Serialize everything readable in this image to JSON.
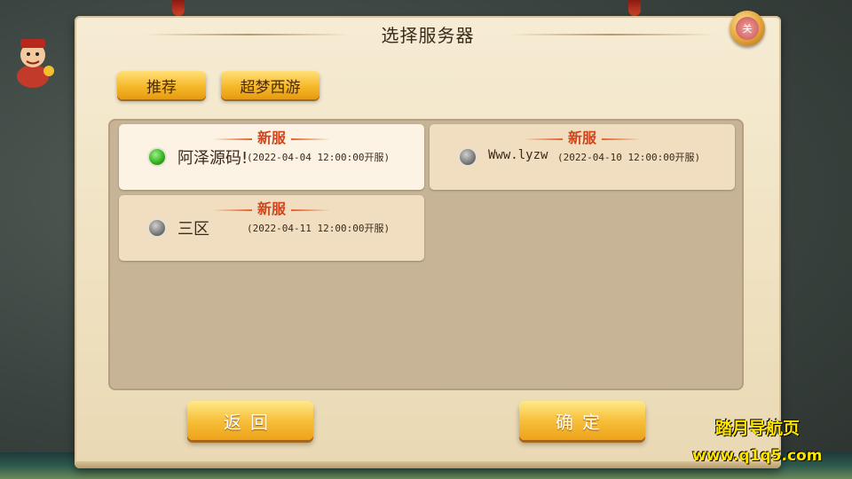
{
  "dialog": {
    "title": "选择服务器",
    "close_label": "关"
  },
  "tabs": [
    {
      "label": "推荐"
    },
    {
      "label": "超梦西游"
    }
  ],
  "servers": [
    {
      "badge": "新服",
      "name": "阿泽源码!",
      "time": "(2022-04-04 12:00:00开服)",
      "selected": true
    },
    {
      "badge": "新服",
      "name": "Www.lyzw",
      "time": "(2022-04-10 12:00:00开服)",
      "selected": false
    },
    {
      "badge": "新服",
      "name": "三区",
      "time": "(2022-04-11 12:00:00开服)",
      "selected": false
    }
  ],
  "buttons": {
    "back": "返回",
    "confirm": "确定"
  },
  "watermark": {
    "line1": "踏月导航页",
    "line2": "www.q1q5.com"
  },
  "colors": {
    "badge": "#d2451c",
    "button": "#f7c03a",
    "selected_radio": "#2eae1a",
    "watermark": "#ffe400"
  }
}
